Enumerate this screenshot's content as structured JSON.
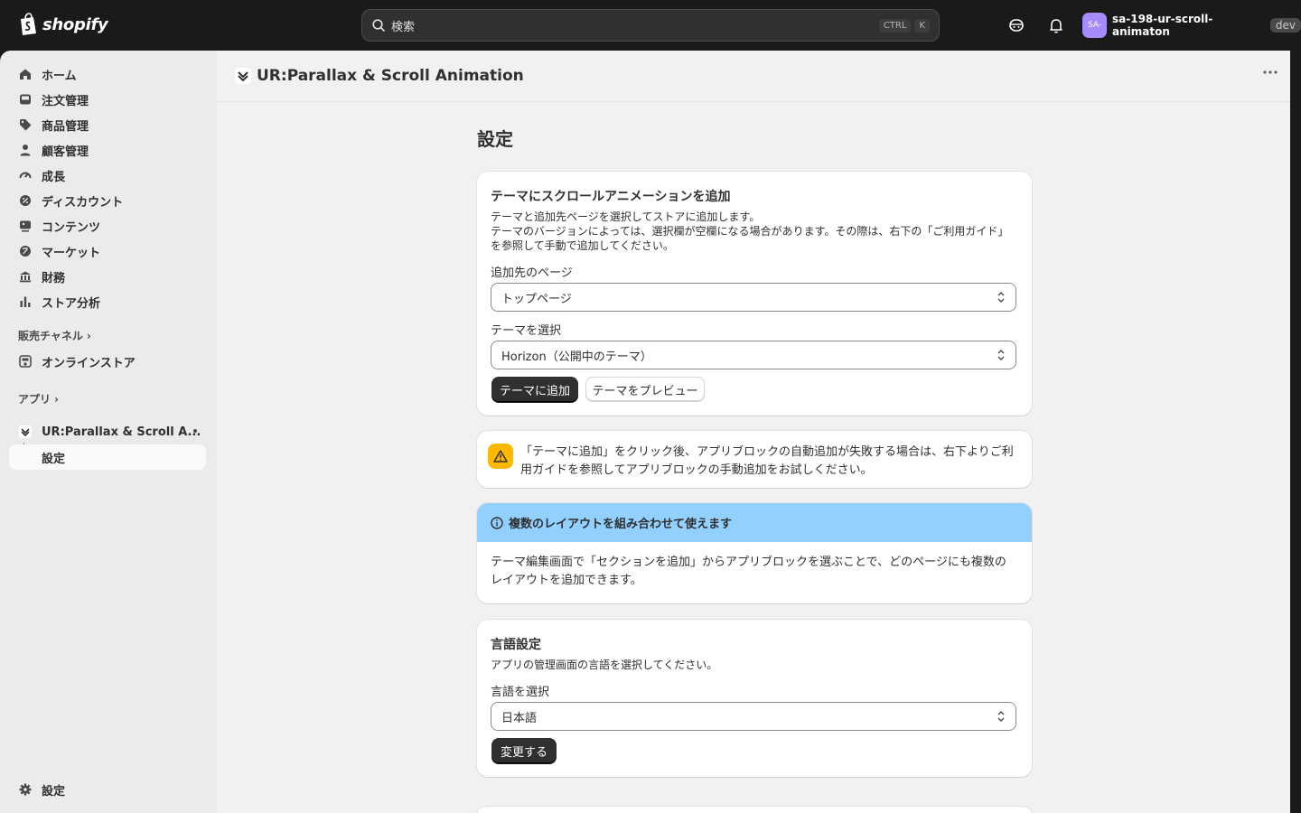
{
  "topbar": {
    "logo_text": "shopify",
    "search_placeholder": "検索",
    "shortcut_ctrl": "CTRL",
    "shortcut_key": "K",
    "avatar_initials": "SA-",
    "store_name": "sa-198-ur-scroll-animaton",
    "dev_badge": "dev"
  },
  "sidebar": {
    "items": [
      {
        "label": "ホーム",
        "icon": "home-icon"
      },
      {
        "label": "注文管理",
        "icon": "inbox-icon"
      },
      {
        "label": "商品管理",
        "icon": "tag-icon"
      },
      {
        "label": "顧客管理",
        "icon": "person-icon"
      },
      {
        "label": "成長",
        "icon": "gauge-icon"
      },
      {
        "label": "ディスカウント",
        "icon": "discount-icon"
      },
      {
        "label": "コンテンツ",
        "icon": "content-icon"
      },
      {
        "label": "マーケット",
        "icon": "globe-icon"
      },
      {
        "label": "財務",
        "icon": "bank-icon"
      },
      {
        "label": "ストア分析",
        "icon": "bar-chart-icon"
      }
    ],
    "sales_channels_label": "販売チャネル",
    "online_store_label": "オンラインストア",
    "apps_label": "アプリ",
    "app_name": "UR:Parallax & Scroll A...",
    "app_sub_settings": "設定",
    "settings_label": "設定"
  },
  "header": {
    "app_title": "UR:Parallax & Scroll Animation"
  },
  "main": {
    "page_title": "設定",
    "add_card": {
      "title": "テーマにスクロールアニメーションを追加",
      "desc1": "テーマと追加先ページを選択してストアに追加します。",
      "desc2": "テーマのバージョンによっては、選択欄が空欄になる場合があります。その際は、右下の「ご利用ガイド」",
      "desc3": "を参照して手動で追加してください。",
      "page_label": "追加先のページ",
      "page_value": "トップページ",
      "theme_label": "テーマを選択",
      "theme_value": "Horizon（公開中のテーマ）",
      "add_button": "テーマに追加",
      "preview_button": "テーマをプレビュー"
    },
    "warning": {
      "line1": "「テーマに追加」をクリック後、アプリブロックの自動追加が失敗する場合は、右下よりご利",
      "line2": "用ガイドを参照してアプリブロックの手動追加をお試しください。"
    },
    "info": {
      "title": "複数のレイアウトを組み合わせて使えます",
      "line1": "テーマ編集画面で「セクションを追加」からアプリブロックを選ぶことで、どのページにも複数の",
      "line2": "レイアウトを追加できます。"
    },
    "language": {
      "title": "言語設定",
      "desc": "アプリの管理画面の言語を選択してください。",
      "select_label": "言語を選択",
      "select_value": "日本語",
      "change_button": "変更する"
    }
  },
  "colors": {
    "topbar_bg": "#1a1a1a",
    "info_banner": "#91d0ff",
    "warning_icon_bg": "#ffb800",
    "avatar_bg": "#a78bfa",
    "primary_button": "#303030"
  }
}
